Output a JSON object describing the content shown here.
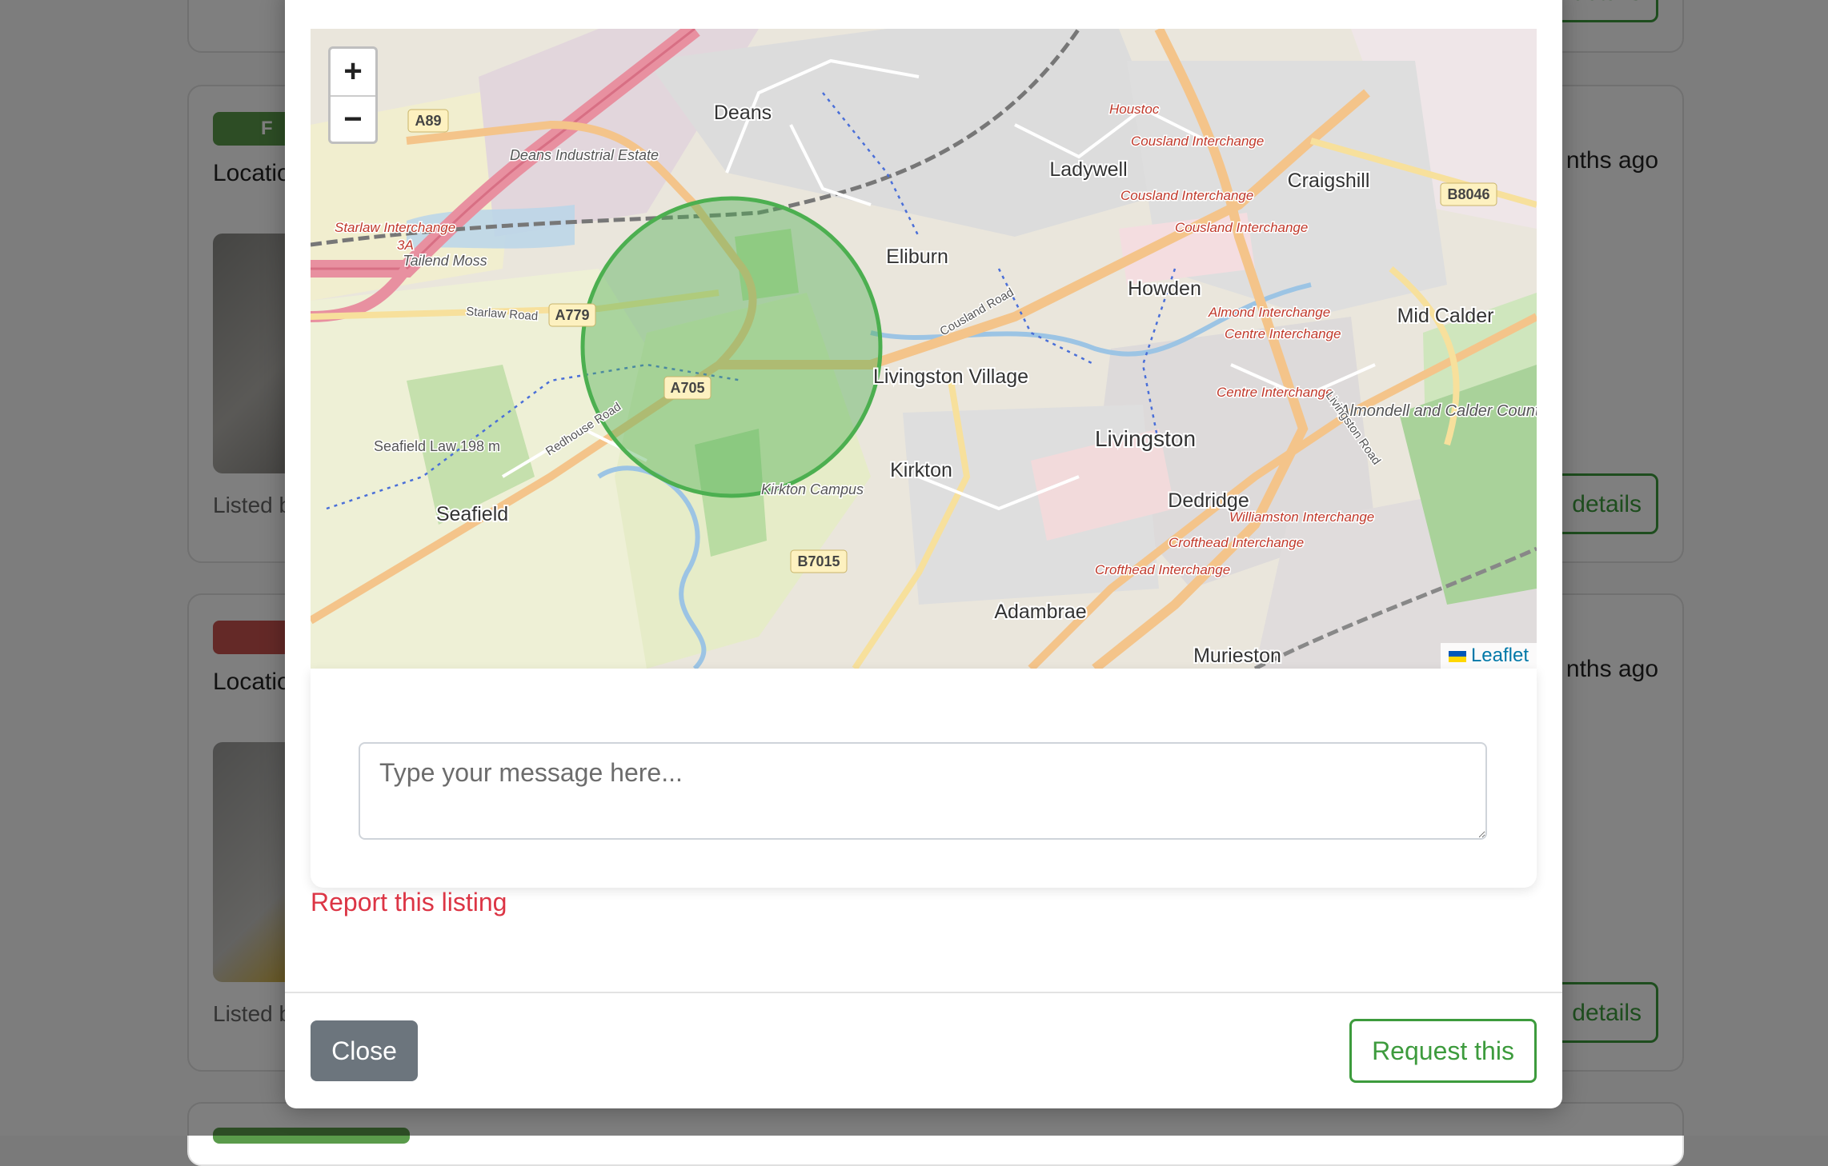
{
  "background": {
    "cards": [
      {
        "badge_label": "F",
        "badge_color": "#5a9b4b",
        "location_label": "Locatio",
        "time_ago": "nths ago",
        "listed_label": "Listed b",
        "details_label": "details"
      },
      {
        "badge_label": "",
        "badge_color": "#c9534f",
        "location_label": "Locatio",
        "time_ago": "nths ago",
        "listed_label": "Listed b",
        "details_label": "details"
      }
    ]
  },
  "modal": {
    "map": {
      "zoom_in_label": "+",
      "zoom_out_label": "−",
      "attribution": "Leaflet",
      "circle_color": "#4caf50",
      "place_labels": {
        "deans": "Deans",
        "deans_industrial": "Deans Industrial Estate",
        "ladywell": "Ladywell",
        "craigshill": "Craigshill",
        "eliburn": "Eliburn",
        "howden": "Howden",
        "mid_calder": "Mid Calder",
        "livingston_village": "Livingston Village",
        "livingston": "Livingston",
        "kirkton": "Kirkton",
        "kirkton_campus": "Kirkton Campus",
        "dedridge": "Dedridge",
        "adambrae": "Adambrae",
        "murieston": "Murieston",
        "seafield": "Seafield",
        "seafield_law": "Seafield Law 198 m",
        "tailend_moss": "Tailend Moss",
        "almondell": "Almondell and Calder Country Park",
        "houston": "Houstoc",
        "starlaw_interchange": "Starlaw Interchange",
        "cousland_interchange": "Cousland Interchange",
        "almond_interchange": "Almond Interchange",
        "centre_interchange": "Centre Interchange",
        "williamston_interchange": "Williamston Interchange",
        "crofthead_interchange": "Crofthead Interchange",
        "starlaw_road": "Starlaw Road",
        "redhouse_road": "Redhouse Road",
        "cousland_road": "Cousland Road",
        "livingston_road": "Livingston Road",
        "junction_3a": "3A"
      },
      "road_shields": {
        "a89": "A89",
        "a779": "A779",
        "a705": "A705",
        "b7015": "B7015",
        "b8046": "B8046"
      }
    },
    "message_placeholder": "Type your message here...",
    "message_value": "",
    "report_label": "Report this listing",
    "close_label": "Close",
    "request_label": "Request this"
  }
}
